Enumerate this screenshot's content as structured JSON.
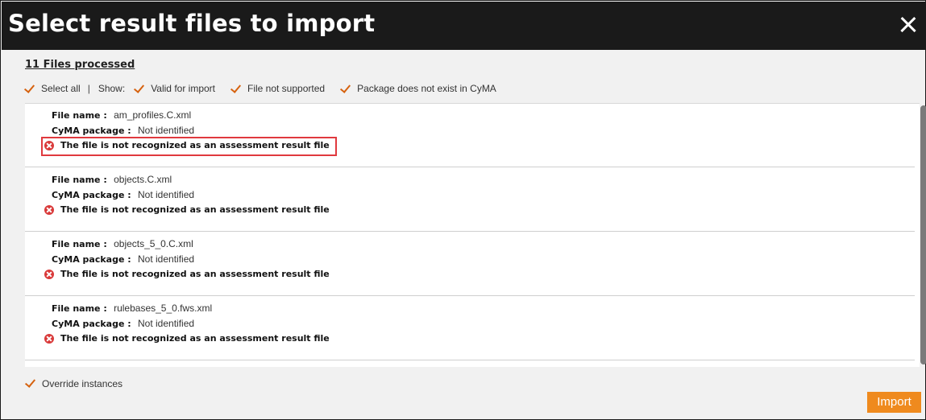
{
  "dialog": {
    "title": "Select result files to import",
    "close_icon": "close-icon"
  },
  "summary": {
    "label": "11 Files processed"
  },
  "filters": {
    "select_all": "Select all",
    "separator": "|",
    "show_label": "Show:",
    "options": [
      {
        "label": "Valid for import",
        "checked": true
      },
      {
        "label": "File not supported",
        "checked": true
      },
      {
        "label": "Package does not exist in CyMA",
        "checked": true
      }
    ]
  },
  "labels": {
    "file_name": "File name :",
    "package": "CyMA package :"
  },
  "files": [
    {
      "name": "am_profiles.C.xml",
      "package": "Not identified",
      "error": "The file is not recognized as an assessment result file"
    },
    {
      "name": "objects.C.xml",
      "package": "Not identified",
      "error": "The file is not recognized as an assessment result file"
    },
    {
      "name": "objects_5_0.C.xml",
      "package": "Not identified",
      "error": "The file is not recognized as an assessment result file"
    },
    {
      "name": "rulebases_5_0.fws.xml",
      "package": "Not identified",
      "error": "The file is not recognized as an assessment result file"
    }
  ],
  "footer": {
    "override_label": "Override instances",
    "override_checked": true,
    "import_label": "Import"
  },
  "colors": {
    "accent": "#ef8a1e",
    "checkmark": "#d6620f",
    "error": "#d93a3a",
    "highlight": "#e0393e",
    "titlebar": "#1a1a1a"
  }
}
